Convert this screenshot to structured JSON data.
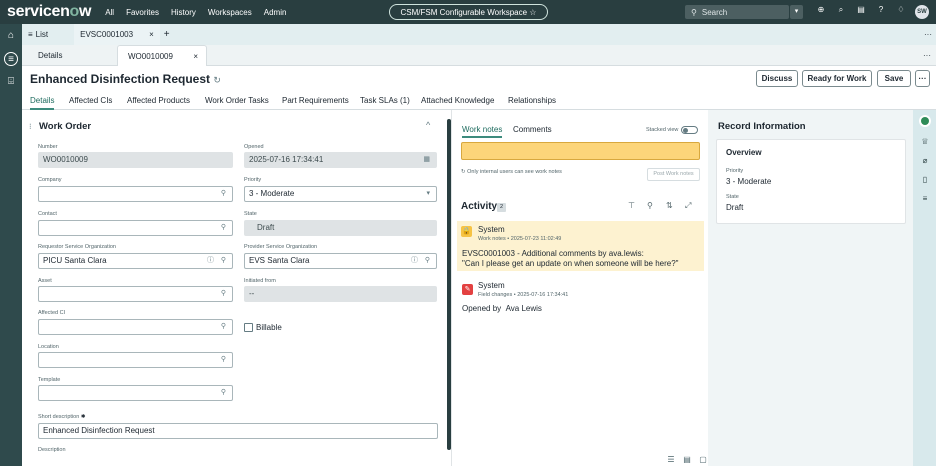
{
  "topnav": {
    "logo_left": "servicen",
    "logo_o": "o",
    "logo_right": "w",
    "menu": [
      "All",
      "Favorites",
      "History",
      "Workspaces",
      "Admin"
    ],
    "workspace_pill": "CSM/FSM Configurable Workspace ☆",
    "search_placeholder": "Search",
    "avatar_initials": "SW"
  },
  "tabs1": {
    "list_label": "List",
    "record_tab": "EVSC0001003"
  },
  "tabs2": {
    "details": "Details",
    "record": "WO0010009"
  },
  "form": {
    "title": "Enhanced Disinfection Request",
    "buttons": {
      "discuss": "Discuss",
      "ready": "Ready for Work",
      "save": "Save",
      "more": "···"
    },
    "tabs": [
      "Details",
      "Affected CIs",
      "Affected Products",
      "Work Order Tasks",
      "Part Requirements",
      "Task SLAs (1)",
      "Attached Knowledge",
      "Relationships"
    ],
    "section_title": "Work Order",
    "fields": {
      "number_label": "Number",
      "number_value": "WO0010009",
      "opened_label": "Opened",
      "opened_value": "2025-07-16 17:34:41",
      "company_label": "Company",
      "priority_label": "Priority",
      "priority_value": "3 - Moderate",
      "contact_label": "Contact",
      "state_label": "State",
      "state_value": "Draft",
      "requestor_org_label": "Requestor Service Organization",
      "requestor_org_value": "PICU Santa Clara",
      "provider_org_label": "Provider Service Organization",
      "provider_org_value": "EVS Santa Clara",
      "asset_label": "Asset",
      "initiated_label": "Initiated from",
      "initiated_value": "--",
      "affected_ci_label": "Affected CI",
      "billable_label": "Billable",
      "location_label": "Location",
      "template_label": "Template",
      "short_desc_label": "Short description",
      "short_desc_value": "Enhanced Disinfection Request",
      "description_label": "Description"
    }
  },
  "activity": {
    "tab_work_notes": "Work notes",
    "tab_comments": "Comments",
    "stacked_view": "Stacked view",
    "internal_note": "Only internal users can see work notes",
    "post_button": "Post Work notes",
    "title": "Activity",
    "count": "2",
    "entries": [
      {
        "user": "System",
        "meta": "Work notes • 2025-07-23 11:02:49",
        "text1": "EVSC0001003 - Additional comments by ava.lewis:",
        "text2": "\"Can I please get an update on when someone will be here?\""
      },
      {
        "user": "System",
        "meta": "Field changes • 2025-07-16 17:34:41",
        "field": "Opened by",
        "value": "Ava Lewis"
      }
    ]
  },
  "record_info": {
    "title": "Record Information",
    "overview": "Overview",
    "priority_label": "Priority",
    "priority_value": "3 - Moderate",
    "state_label": "State",
    "state_value": "Draft"
  }
}
